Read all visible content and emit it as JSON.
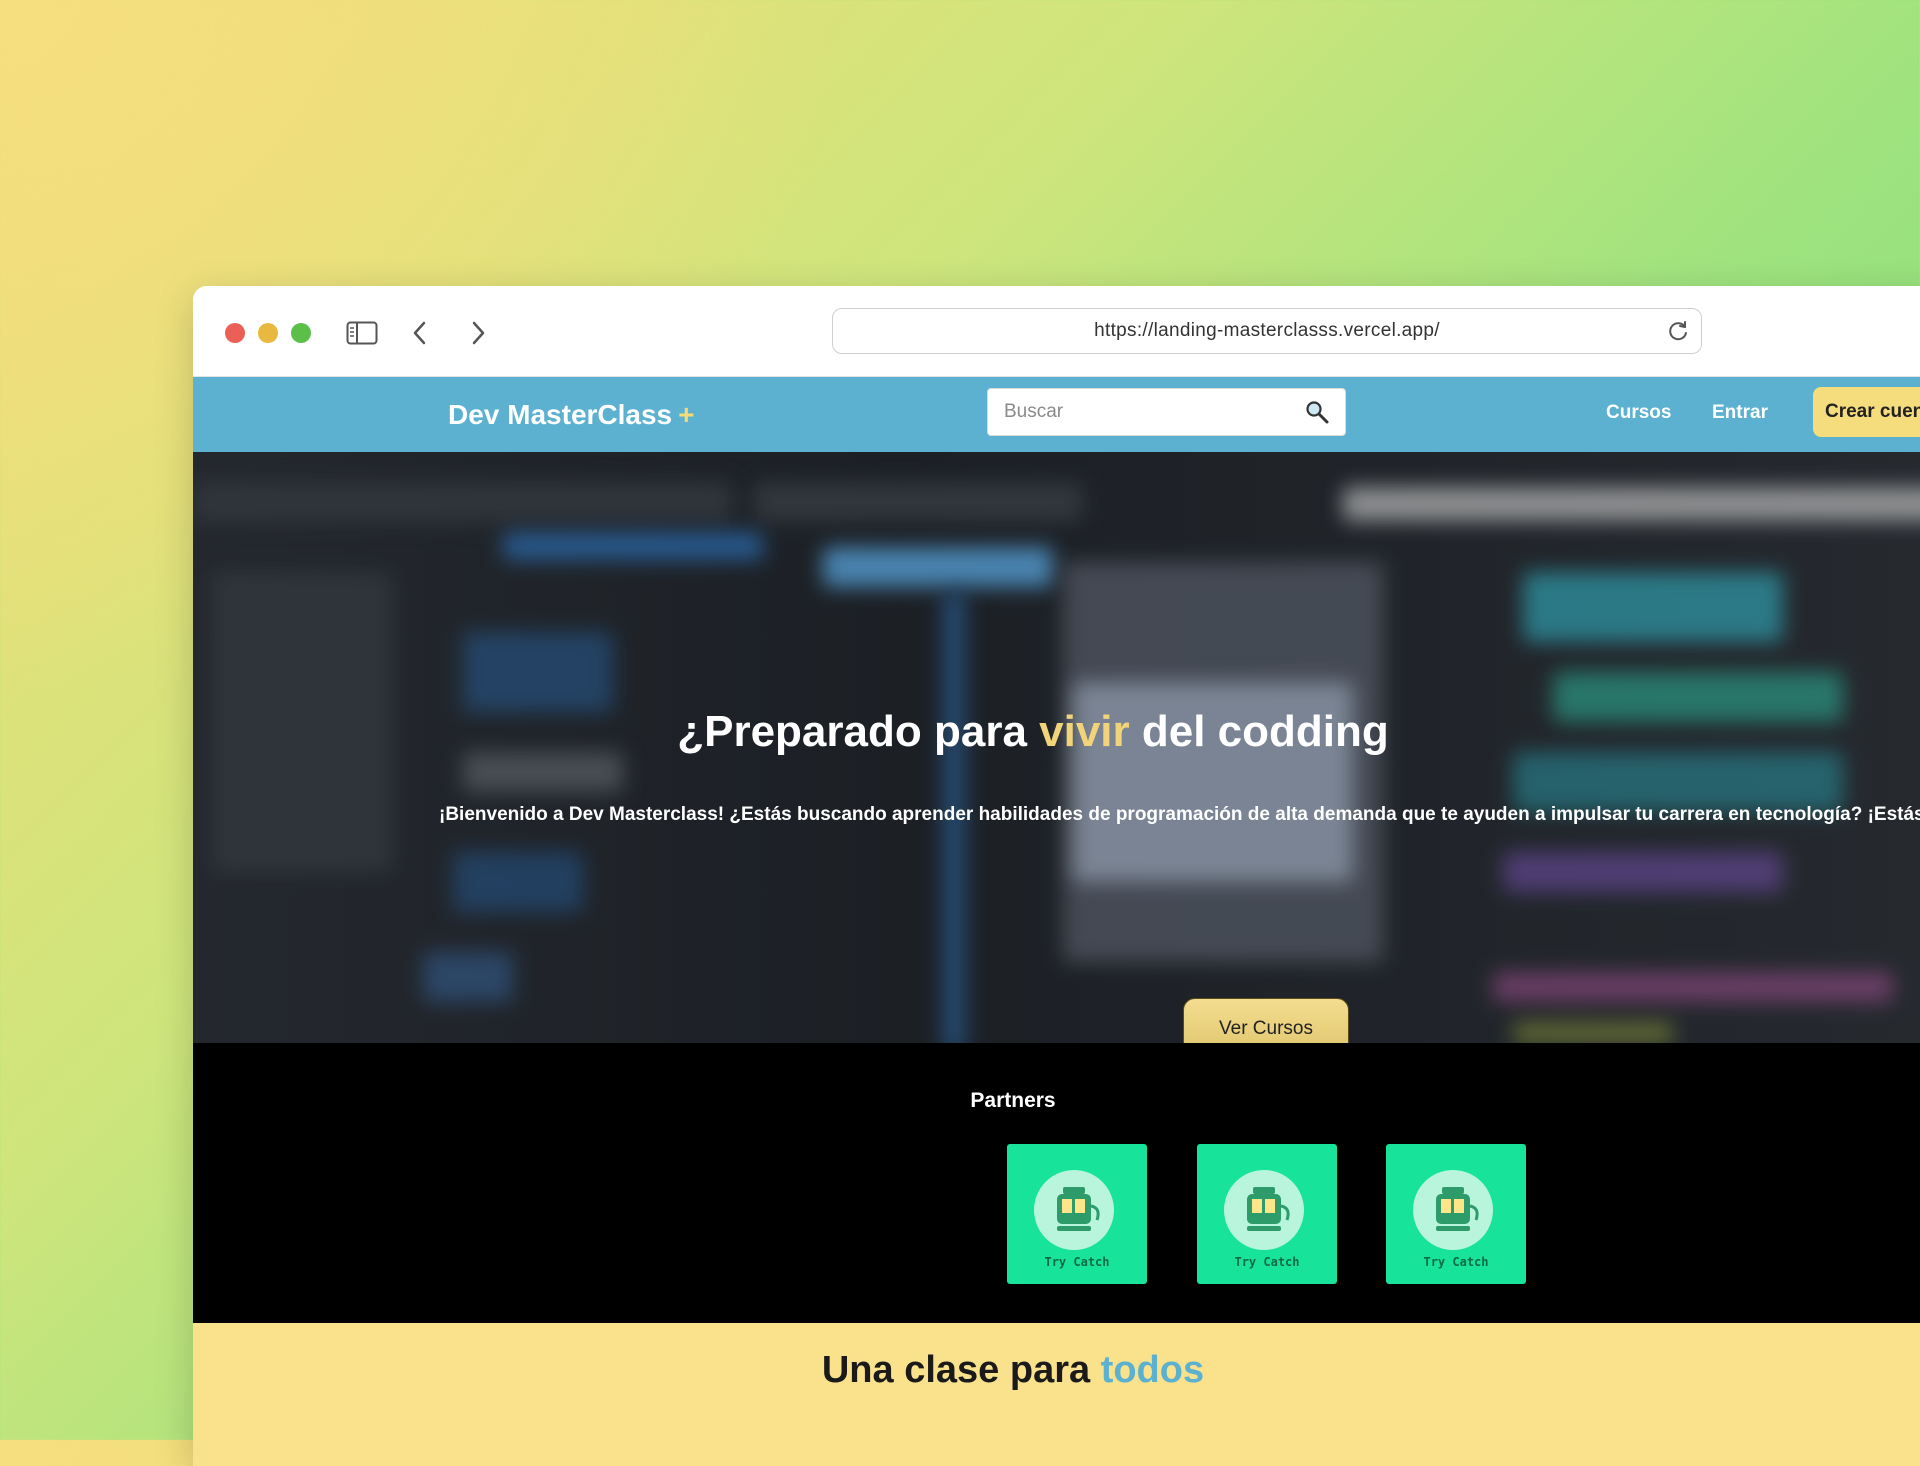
{
  "browser": {
    "url": "https://landing-masterclasss.vercel.app/"
  },
  "nav": {
    "brand": "Dev MasterClass",
    "brand_plus": "+",
    "search_placeholder": "Buscar",
    "links": [
      "Cursos",
      "Entrar"
    ],
    "cta": "Crear cuenta"
  },
  "hero": {
    "title_pre": "¿Preparado para ",
    "title_highlight": "vivir",
    "title_post": " del codding",
    "subtitle": "¡Bienvenido a Dev Masterclass! ¿Estás buscando aprender habilidades de programación de alta demanda que te ayuden a impulsar tu carrera en tecnología? ¡Estás en",
    "button": "Ver Cursos"
  },
  "partners": {
    "heading": "Partners",
    "items": [
      "Try Catch",
      "Try Catch",
      "Try Catch"
    ]
  },
  "section": {
    "title_pre": "Una clase para ",
    "title_highlight": "todos"
  },
  "colors": {
    "nav_bg": "#5bb1cf",
    "accent_yellow": "#f5dc7c",
    "partner_green": "#17e39b",
    "section_bg": "#fae28d"
  }
}
